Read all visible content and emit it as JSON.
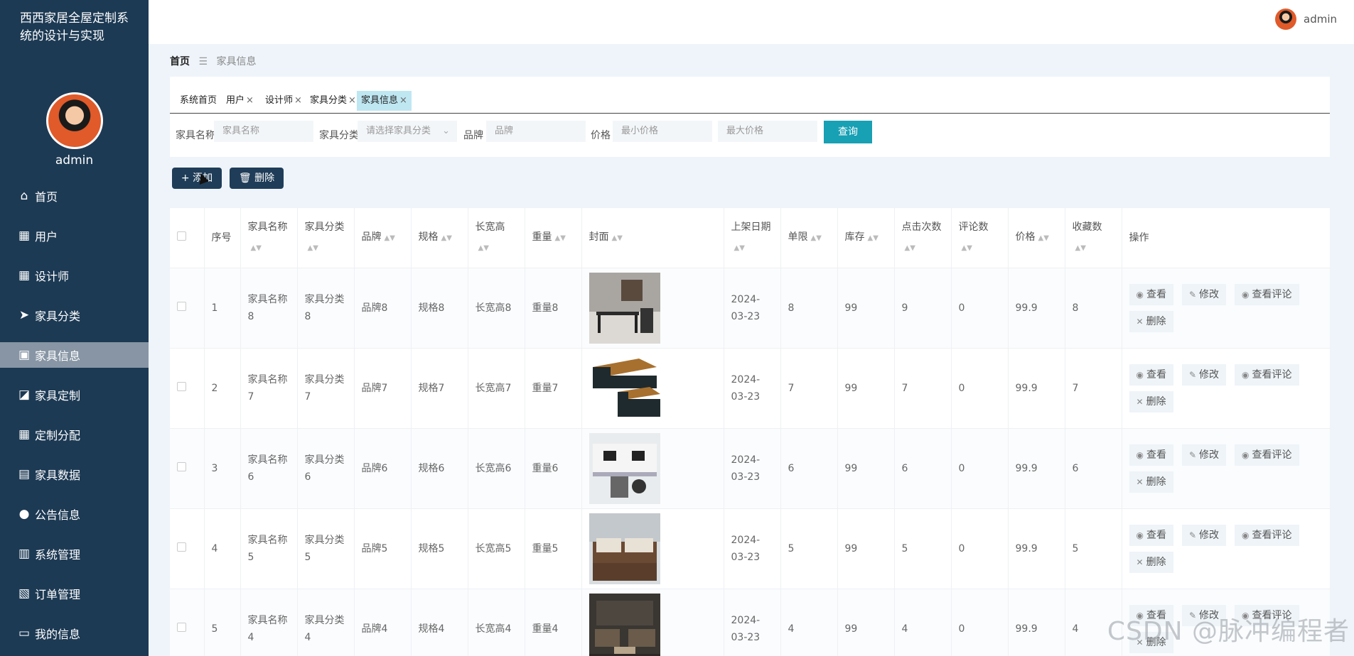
{
  "sidebar": {
    "title": "西西家居全屋定制系统的设计与实现",
    "username": "admin",
    "items": [
      {
        "label": "首页",
        "icon": "home-icon",
        "glyph": "⌂"
      },
      {
        "label": "用户",
        "icon": "grid-icon",
        "glyph": "▦"
      },
      {
        "label": "设计师",
        "icon": "grid-icon",
        "glyph": "▦"
      },
      {
        "label": "家具分类",
        "icon": "send-icon",
        "glyph": "➤"
      },
      {
        "label": "家具信息",
        "icon": "wallet-icon",
        "glyph": "▣"
      },
      {
        "label": "家具定制",
        "icon": "chart-icon",
        "glyph": "◪"
      },
      {
        "label": "定制分配",
        "icon": "grid-icon",
        "glyph": "▦"
      },
      {
        "label": "家具数据",
        "icon": "excel-icon",
        "glyph": "▤"
      },
      {
        "label": "公告信息",
        "icon": "bulb-icon",
        "glyph": "●"
      },
      {
        "label": "系统管理",
        "icon": "bar-chart-icon",
        "glyph": "▥"
      },
      {
        "label": "订单管理",
        "icon": "clipboard-icon",
        "glyph": "▧"
      },
      {
        "label": "我的信息",
        "icon": "card-icon",
        "glyph": "▭"
      }
    ]
  },
  "topbar": {
    "username": "admin"
  },
  "breadcrumb": {
    "home": "首页",
    "separator": "☰",
    "current": "家具信息"
  },
  "tabs": [
    "系统首页",
    "用户",
    "设计师",
    "家具分类",
    "家具信息"
  ],
  "tab_close": "×",
  "search": {
    "name_label": "家具名称",
    "name_placeholder": "家具名称",
    "category_label": "家具分类",
    "category_placeholder": "请选择家具分类",
    "brand_label": "品牌",
    "brand_placeholder": "品牌",
    "price_label": "价格",
    "min_placeholder": "最小价格",
    "max_placeholder": "最大价格",
    "query_button": "查询"
  },
  "actions": {
    "add": "+ 添加",
    "delete": "🗑 删除"
  },
  "table": {
    "headers": [
      "序号",
      "家具名称",
      "家具分类",
      "品牌",
      "规格",
      "长宽高",
      "重量",
      "封面",
      "上架日期",
      "单限",
      "库存",
      "点击次数",
      "评论数",
      "价格",
      "收藏数",
      "操作"
    ],
    "sort_glyph": "▲▼",
    "op_labels": {
      "view": "查看",
      "edit": "修改",
      "comments": "查看评论",
      "delete": "删除"
    },
    "rows": [
      {
        "idx": "1",
        "name": "家具名称8",
        "category": "家具分类8",
        "brand": "品牌8",
        "spec": "规格8",
        "dims": "长宽高8",
        "weight": "重量8",
        "date": "2024-03-23",
        "limit": "8",
        "stock": "99",
        "clicks": "9",
        "comments": "0",
        "price": "99.9",
        "favorites": "8"
      },
      {
        "idx": "2",
        "name": "家具名称7",
        "category": "家具分类7",
        "brand": "品牌7",
        "spec": "规格7",
        "dims": "长宽高7",
        "weight": "重量7",
        "date": "2024-03-23",
        "limit": "7",
        "stock": "99",
        "clicks": "7",
        "comments": "0",
        "price": "99.9",
        "favorites": "7"
      },
      {
        "idx": "3",
        "name": "家具名称6",
        "category": "家具分类6",
        "brand": "品牌6",
        "spec": "规格6",
        "dims": "长宽高6",
        "weight": "重量6",
        "date": "2024-03-23",
        "limit": "6",
        "stock": "99",
        "clicks": "6",
        "comments": "0",
        "price": "99.9",
        "favorites": "6"
      },
      {
        "idx": "4",
        "name": "家具名称5",
        "category": "家具分类5",
        "brand": "品牌5",
        "spec": "规格5",
        "dims": "长宽高5",
        "weight": "重量5",
        "date": "2024-03-23",
        "limit": "5",
        "stock": "99",
        "clicks": "5",
        "comments": "0",
        "price": "99.9",
        "favorites": "5"
      },
      {
        "idx": "5",
        "name": "家具名称4",
        "category": "家具分类4",
        "brand": "品牌4",
        "spec": "规格4",
        "dims": "长宽高4",
        "weight": "重量4",
        "date": "2024-03-23",
        "limit": "4",
        "stock": "99",
        "clicks": "4",
        "comments": "0",
        "price": "99.9",
        "favorites": "4"
      }
    ]
  },
  "watermark": "CSDN @脉冲编程者"
}
